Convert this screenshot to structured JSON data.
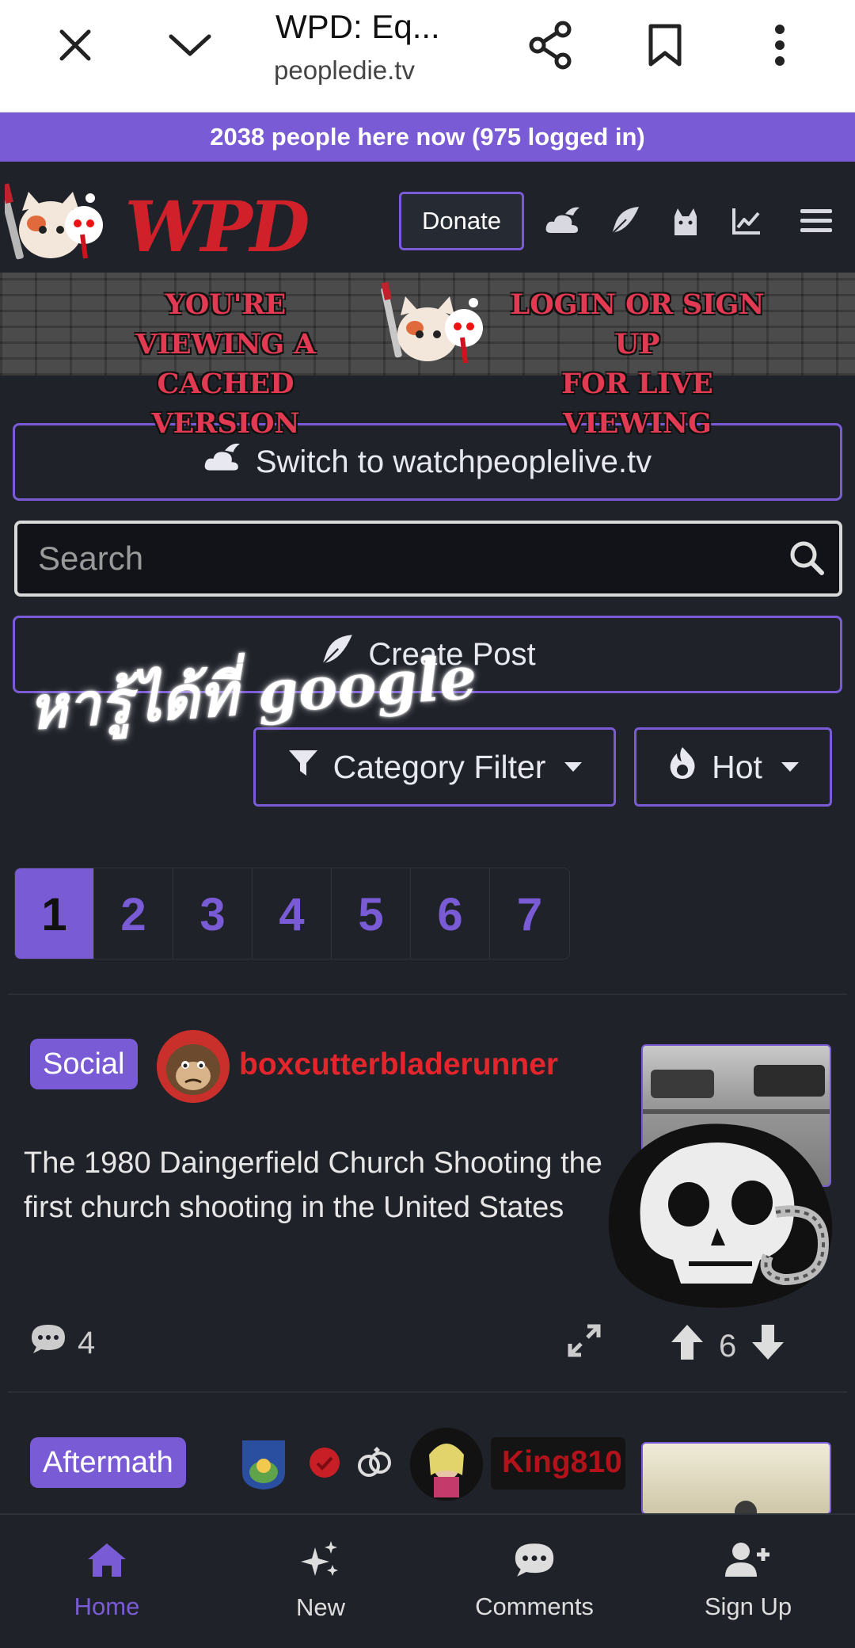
{
  "browser": {
    "title": "WPD: Eq...",
    "url": "peopledie.tv"
  },
  "online": {
    "text": "2038 people here now (975 logged in)"
  },
  "header": {
    "logo_text": "WPD",
    "donate_label": "Donate",
    "icons": [
      "cloud-bird-icon",
      "feather-icon",
      "cat-icon",
      "chart-line-icon",
      "menu-icon"
    ]
  },
  "banner": {
    "left_line1": "YOU'RE VIEWING A",
    "left_line2": "CACHED VERSION",
    "right_line1": "LOGIN OR SIGN UP",
    "right_line2": "FOR LIVE VIEWING"
  },
  "switch_button": {
    "label": "Switch to watchpeoplelive.tv"
  },
  "search": {
    "placeholder": "Search"
  },
  "create_post": {
    "label": "Create Post"
  },
  "overlay_text": "หารู้ได้ที่ google",
  "filters": {
    "category_label": "Category Filter",
    "sort_label": "Hot"
  },
  "pagination": {
    "pages": [
      "1",
      "2",
      "3",
      "4",
      "5",
      "6",
      "7"
    ],
    "active": "1"
  },
  "posts": [
    {
      "tag": "Social",
      "username": "boxcutterbladerunner",
      "title": "The 1980 Daingerfield Church Shooting the first church shooting in the United States",
      "comments": "4",
      "score": "6"
    },
    {
      "tag": "Aftermath",
      "username": "King810"
    }
  ],
  "bottom_nav": [
    {
      "label": "Home",
      "icon": "home-icon"
    },
    {
      "label": "New",
      "icon": "sparkles-icon"
    },
    {
      "label": "Comments",
      "icon": "comment-icon"
    },
    {
      "label": "Sign Up",
      "icon": "user-plus-icon"
    }
  ],
  "colors": {
    "accent": "#7a5bd6",
    "background": "#1f2229",
    "username_red": "#e4262c"
  }
}
